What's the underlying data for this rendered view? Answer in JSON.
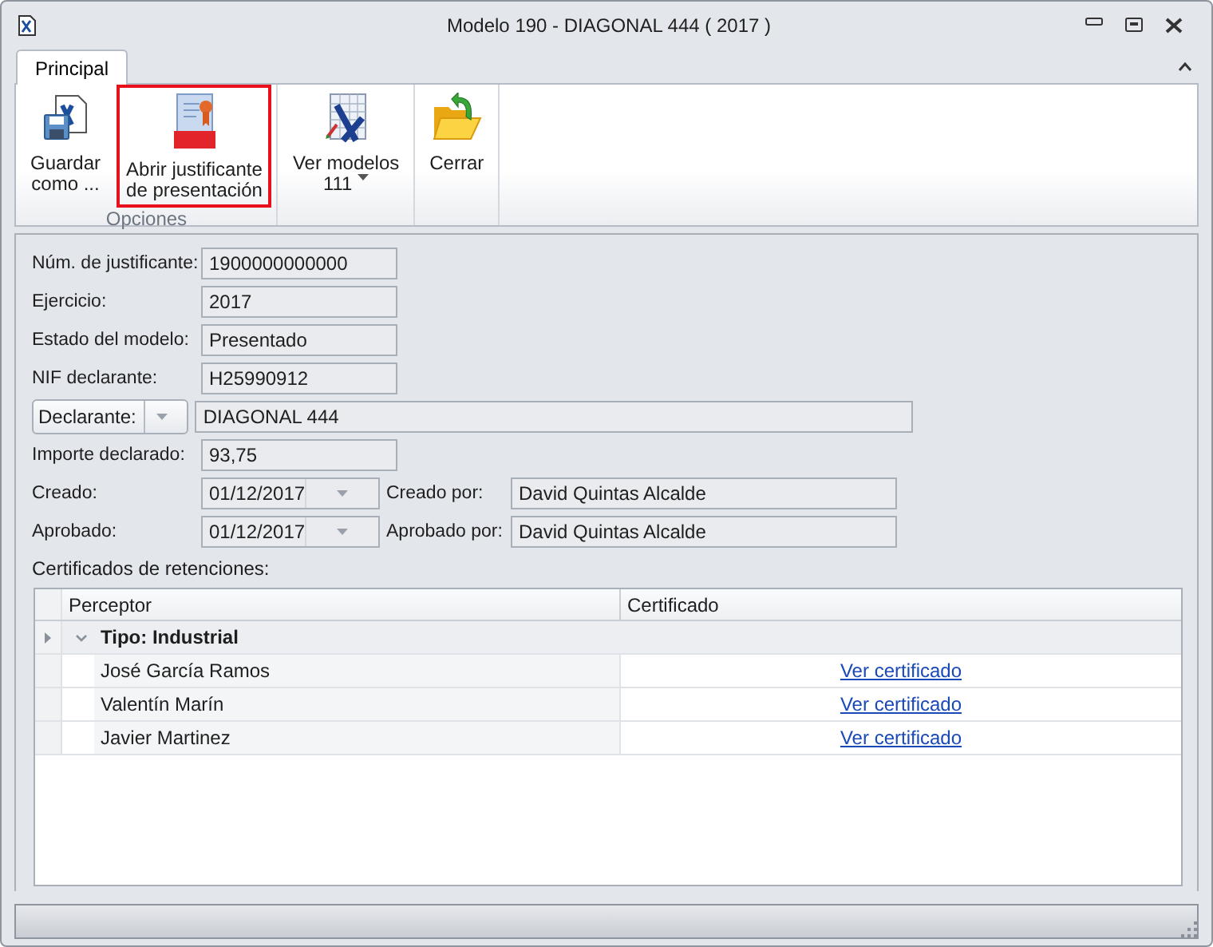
{
  "window": {
    "title": "Modelo 190 - DIAGONAL 444 ( 2017 )"
  },
  "tabs": [
    {
      "label": "Principal",
      "selected": true
    }
  ],
  "ribbon": {
    "groups": [
      {
        "label": "Opciones",
        "buttons": [
          {
            "kind": "save",
            "lines": [
              "Guardar",
              "como ..."
            ],
            "highlighted": false,
            "dropdown": false
          },
          {
            "kind": "pdf",
            "lines": [
              "Abrir justificante",
              "de presentación"
            ],
            "highlighted": true,
            "dropdown": false
          }
        ]
      },
      {
        "buttons": [
          {
            "kind": "grid",
            "lines": [
              "Ver modelos",
              "111"
            ],
            "highlighted": false,
            "dropdown": true
          }
        ]
      },
      {
        "buttons": [
          {
            "kind": "folder",
            "lines": [
              "Cerrar"
            ],
            "highlighted": false,
            "dropdown": false
          }
        ]
      }
    ]
  },
  "form": {
    "rows": [
      {
        "kind": "text",
        "label": "Núm. de justificante:",
        "value": "1900000000000"
      },
      {
        "kind": "text",
        "label": "Ejercicio:",
        "value": "2017"
      },
      {
        "kind": "text",
        "label": "Estado del modelo:",
        "value": "Presentado"
      },
      {
        "kind": "text",
        "label": "NIF declarante:",
        "value": "H25990912"
      },
      {
        "kind": "selector",
        "label": "Declarante:",
        "value": "DIAGONAL 444"
      },
      {
        "kind": "text",
        "label": "Importe declarado:",
        "value": "93,75"
      },
      {
        "kind": "date_user",
        "label": "Creado:",
        "value": "01/12/2017",
        "user_label": "Creado por:",
        "user": "David Quintas Alcalde"
      },
      {
        "kind": "date_user",
        "label": "Aprobado:",
        "value": "01/12/2017",
        "user_label": "Aprobado por:",
        "user": "David Quintas Alcalde"
      }
    ]
  },
  "grid": {
    "caption": "Certificados de retenciones:",
    "columns": [
      "Perceptor",
      "Certificado"
    ],
    "groups": [
      {
        "label": "Tipo: Industrial",
        "expanded": true,
        "current": true,
        "rows": [
          {
            "perceptor": "José García Ramos",
            "certificado": "Ver certificado"
          },
          {
            "perceptor": "Valentín Marín",
            "certificado": "Ver certificado"
          },
          {
            "perceptor": "Javier Martinez",
            "certificado": "Ver certificado"
          }
        ]
      }
    ]
  }
}
